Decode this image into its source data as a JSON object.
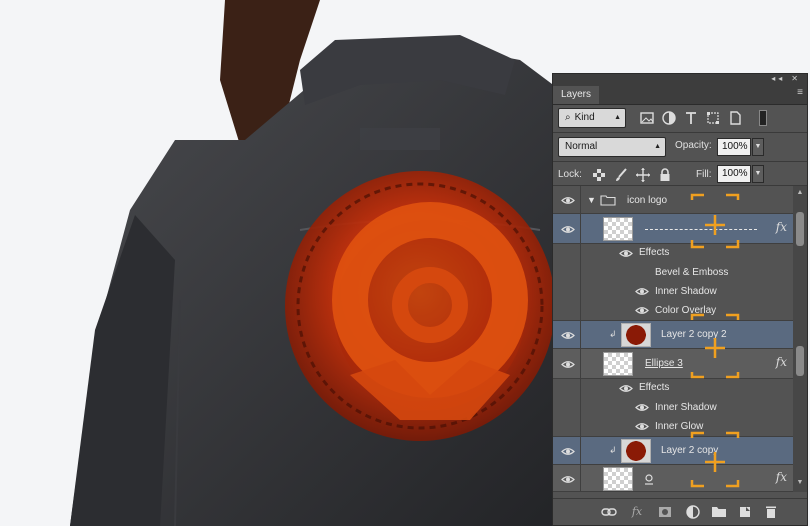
{
  "panel": {
    "collapse_glyph": "◂◂",
    "close_glyph": "✕",
    "tab_label": "Layers",
    "tab_menu_glyph": "≡",
    "filter": {
      "search_glyph": "⌕",
      "value": "Kind"
    },
    "blend_mode": "Normal",
    "opacity_label": "Opacity:",
    "opacity_value": "100%",
    "lock_label": "Lock:",
    "fill_label": "Fill:",
    "fill_value": "100%"
  },
  "layers": {
    "group": {
      "name": "icon logo"
    },
    "shape_layer_1": {
      "effects_label": "Effects",
      "effects": [
        "Bevel & Emboss",
        "Inner Shadow",
        "Color Overlay"
      ]
    },
    "layer_2_copy_2": {
      "name": "Layer 2 copy 2"
    },
    "ellipse_3": {
      "name": "Ellipse 3",
      "effects_label": "Effects",
      "effects": [
        "Inner Shadow",
        "Inner Glow"
      ]
    },
    "layer_2_copy": {
      "name": "Layer 2 copy"
    },
    "fx_glyph": "fx"
  },
  "colors": {
    "panel_bg": "#535353",
    "selected_row": "#5a6a80",
    "annotation_orange": "#f0a020",
    "emblem_red": "#c8300a"
  }
}
